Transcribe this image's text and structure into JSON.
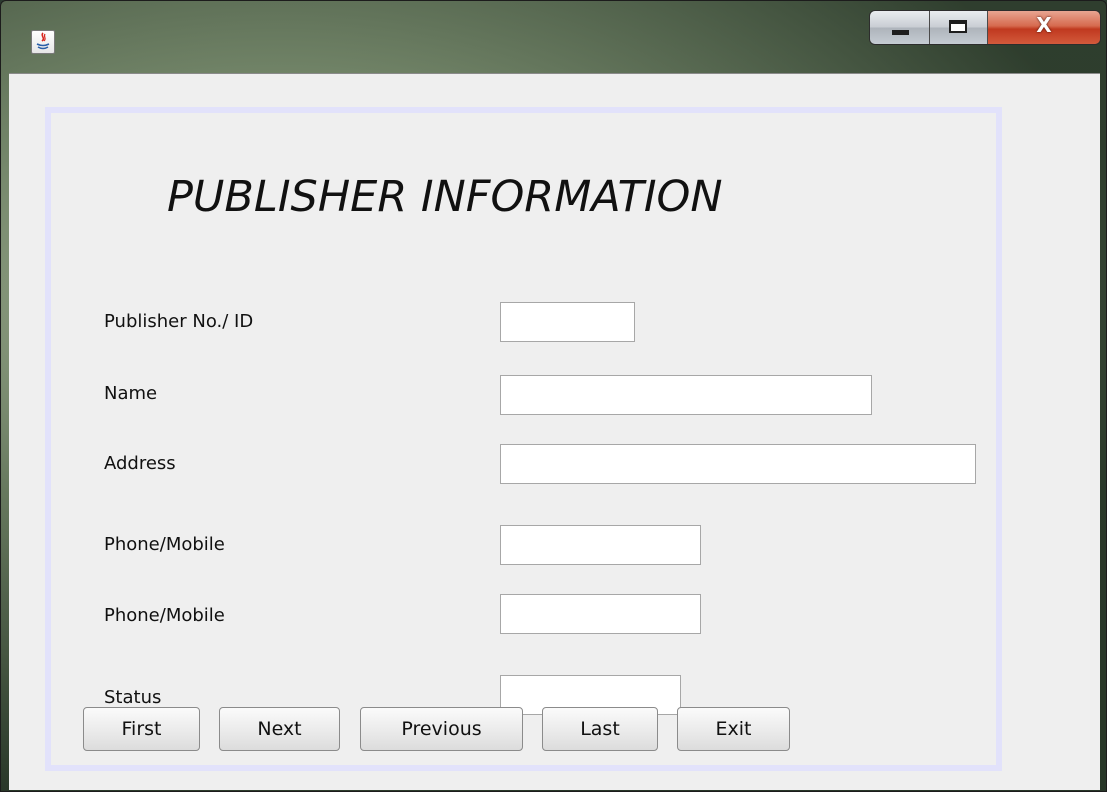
{
  "window": {
    "title": "",
    "controls": {
      "minimize": "minimize-icon",
      "maximize": "maximize-icon",
      "close_label": "X"
    },
    "accent_close": "#c0391f"
  },
  "form": {
    "heading": "PUBLISHER INFORMATION",
    "fields": [
      {
        "label": "Publisher No./ ID",
        "value": ""
      },
      {
        "label": "Name",
        "value": ""
      },
      {
        "label": "Address",
        "value": ""
      },
      {
        "label": "Phone/Mobile",
        "value": ""
      },
      {
        "label": "Phone/Mobile",
        "value": ""
      },
      {
        "label": "Status",
        "value": ""
      }
    ]
  },
  "buttons": {
    "first": "First",
    "next": "Next",
    "previous": "Previous",
    "last": "Last",
    "exit": "Exit"
  }
}
